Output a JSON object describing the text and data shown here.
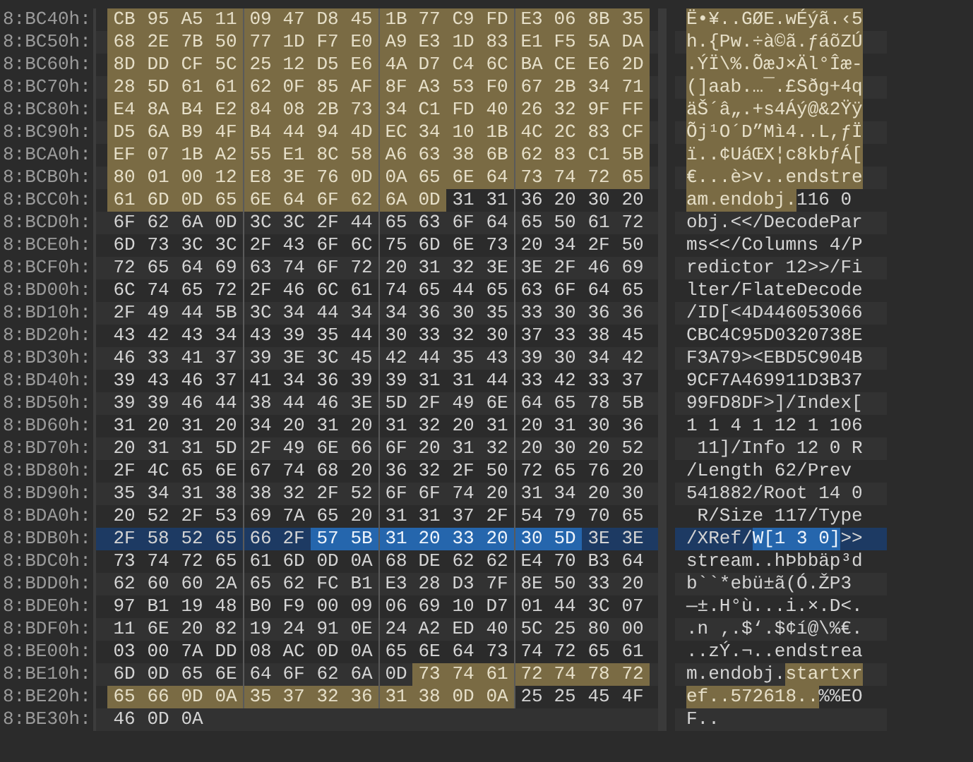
{
  "rows": [
    {
      "address": "8:BC40h:",
      "current": false,
      "segments": [
        {
          "kind": "marked",
          "bytes": "CB 95 A5 11 09 47 D8 45 1B 77 C9 FD E3 06 8B 35",
          "text": "Ë•¥..GØE.wÉýã.‹5"
        }
      ]
    },
    {
      "address": "8:BC50h:",
      "current": false,
      "segments": [
        {
          "kind": "marked",
          "bytes": "68 2E 7B 50 77 1D F7 E0 A9 E3 1D 83 E1 F5 5A DA",
          "text": "h.{Pw.÷à©ã.ƒáõZÚ"
        }
      ]
    },
    {
      "address": "8:BC60h:",
      "current": false,
      "segments": [
        {
          "kind": "marked",
          "bytes": "8D DD CF 5C 25 12 D5 E6 4A D7 C4 6C BA CE E6 2D",
          "text": ".ÝÏ\\%.ÕæJ×Äl°Îæ-"
        }
      ]
    },
    {
      "address": "8:BC70h:",
      "current": false,
      "segments": [
        {
          "kind": "marked",
          "bytes": "28 5D 61 61 62 0F 85 AF 8F A3 53 F0 67 2B 34 71",
          "text": "(]aab.…¯.£Sðg+4q"
        }
      ]
    },
    {
      "address": "8:BC80h:",
      "current": false,
      "segments": [
        {
          "kind": "marked",
          "bytes": "E4 8A B4 E2 84 08 2B 73 34 C1 FD 40 26 32 9F FF",
          "text": "äŠ´â„.+s4Áý@&2Ÿÿ"
        }
      ]
    },
    {
      "address": "8:BC90h:",
      "current": false,
      "segments": [
        {
          "kind": "marked",
          "bytes": "D5 6A B9 4F B4 44 94 4D EC 34 10 1B 4C 2C 83 CF",
          "text": "Õj¹O´D”Mì4..L,ƒÏ"
        }
      ]
    },
    {
      "address": "8:BCA0h:",
      "current": false,
      "segments": [
        {
          "kind": "marked",
          "bytes": "EF 07 1B A2 55 E1 8C 58 A6 63 38 6B 62 83 C1 5B",
          "text": "ï..¢UáŒX¦c8kbƒÁ["
        }
      ]
    },
    {
      "address": "8:BCB0h:",
      "current": false,
      "segments": [
        {
          "kind": "marked",
          "bytes": "80 01 00 12 E8 3E 76 0D 0A 65 6E 64 73 74 72 65",
          "text": "€...è>v..endstre"
        }
      ]
    },
    {
      "address": "8:BCC0h:",
      "current": false,
      "segments": [
        {
          "kind": "marked",
          "bytes": "61 6D 0D 65 6E 64 6F 62 6A 0D",
          "text": "am.endobj."
        },
        {
          "kind": "plain",
          "bytes": "31 31 36 20 30 20",
          "text": "116 0 "
        }
      ]
    },
    {
      "address": "8:BCD0h:",
      "current": false,
      "segments": [
        {
          "kind": "plain",
          "bytes": "6F 62 6A 0D 3C 3C 2F 44 65 63 6F 64 65 50 61 72",
          "text": "obj.<</DecodePar"
        }
      ]
    },
    {
      "address": "8:BCE0h:",
      "current": false,
      "segments": [
        {
          "kind": "plain",
          "bytes": "6D 73 3C 3C 2F 43 6F 6C 75 6D 6E 73 20 34 2F 50",
          "text": "ms<</Columns 4/P"
        }
      ]
    },
    {
      "address": "8:BCF0h:",
      "current": false,
      "segments": [
        {
          "kind": "plain",
          "bytes": "72 65 64 69 63 74 6F 72 20 31 32 3E 3E 2F 46 69",
          "text": "redictor 12>>/Fi"
        }
      ]
    },
    {
      "address": "8:BD00h:",
      "current": false,
      "segments": [
        {
          "kind": "plain",
          "bytes": "6C 74 65 72 2F 46 6C 61 74 65 44 65 63 6F 64 65",
          "text": "lter/FlateDecode"
        }
      ]
    },
    {
      "address": "8:BD10h:",
      "current": false,
      "segments": [
        {
          "kind": "plain",
          "bytes": "2F 49 44 5B 3C 34 44 34 34 36 30 35 33 30 36 36",
          "text": "/ID[<4D446053066"
        }
      ]
    },
    {
      "address": "8:BD20h:",
      "current": false,
      "segments": [
        {
          "kind": "plain",
          "bytes": "43 42 43 34 43 39 35 44 30 33 32 30 37 33 38 45",
          "text": "CBC4C95D0320738E"
        }
      ]
    },
    {
      "address": "8:BD30h:",
      "current": false,
      "segments": [
        {
          "kind": "plain",
          "bytes": "46 33 41 37 39 3E 3C 45 42 44 35 43 39 30 34 42",
          "text": "F3A79><EBD5C904B"
        }
      ]
    },
    {
      "address": "8:BD40h:",
      "current": false,
      "segments": [
        {
          "kind": "plain",
          "bytes": "39 43 46 37 41 34 36 39 39 31 31 44 33 42 33 37",
          "text": "9CF7A469911D3B37"
        }
      ]
    },
    {
      "address": "8:BD50h:",
      "current": false,
      "segments": [
        {
          "kind": "plain",
          "bytes": "39 39 46 44 38 44 46 3E 5D 2F 49 6E 64 65 78 5B",
          "text": "99FD8DF>]/Index["
        }
      ]
    },
    {
      "address": "8:BD60h:",
      "current": false,
      "segments": [
        {
          "kind": "plain",
          "bytes": "31 20 31 20 34 20 31 20 31 32 20 31 20 31 30 36",
          "text": "1 1 4 1 12 1 106"
        }
      ]
    },
    {
      "address": "8:BD70h:",
      "current": false,
      "segments": [
        {
          "kind": "plain",
          "bytes": "20 31 31 5D 2F 49 6E 66 6F 20 31 32 20 30 20 52",
          "text": " 11]/Info 12 0 R"
        }
      ]
    },
    {
      "address": "8:BD80h:",
      "current": false,
      "segments": [
        {
          "kind": "plain",
          "bytes": "2F 4C 65 6E 67 74 68 20 36 32 2F 50 72 65 76 20",
          "text": "/Length 62/Prev "
        }
      ]
    },
    {
      "address": "8:BD90h:",
      "current": false,
      "segments": [
        {
          "kind": "plain",
          "bytes": "35 34 31 38 38 32 2F 52 6F 6F 74 20 31 34 20 30",
          "text": "541882/Root 14 0"
        }
      ]
    },
    {
      "address": "8:BDA0h:",
      "current": false,
      "segments": [
        {
          "kind": "plain",
          "bytes": "20 52 2F 53 69 7A 65 20 31 31 37 2F 54 79 70 65",
          "text": " R/Size 117/Type"
        }
      ]
    },
    {
      "address": "8:BDB0h:",
      "current": true,
      "segments": [
        {
          "kind": "plain",
          "bytes": "2F 58 52 65 66 2F",
          "text": "/XRef/"
        },
        {
          "kind": "selected",
          "bytes": "57 5B 31 20 33 20 30 5D",
          "text": "W[1 3 0]"
        },
        {
          "kind": "plain",
          "bytes": "3E 3E",
          "text": ">>"
        }
      ]
    },
    {
      "address": "8:BDC0h:",
      "current": false,
      "segments": [
        {
          "kind": "plain",
          "bytes": "73 74 72 65 61 6D 0D 0A 68 DE 62 62 E4 70 B3 64",
          "text": "stream..hÞbbäp³d"
        }
      ]
    },
    {
      "address": "8:BDD0h:",
      "current": false,
      "segments": [
        {
          "kind": "plain",
          "bytes": "62 60 60 2A 65 62 FC B1 E3 28 D3 7F 8E 50 33 20",
          "text": "b``*ebü±ã(Ó.ŽP3 "
        }
      ]
    },
    {
      "address": "8:BDE0h:",
      "current": false,
      "segments": [
        {
          "kind": "plain",
          "bytes": "97 B1 19 48 B0 F9 00 09 06 69 10 D7 01 44 3C 07",
          "text": "—±.H°ù...i.×.D<."
        }
      ]
    },
    {
      "address": "8:BDF0h:",
      "current": false,
      "segments": [
        {
          "kind": "plain",
          "bytes": "11 6E 20 82 19 24 91 0E 24 A2 ED 40 5C 25 80 00",
          "text": ".n ‚.$‘.$¢í@\\%€."
        }
      ]
    },
    {
      "address": "8:BE00h:",
      "current": false,
      "segments": [
        {
          "kind": "plain",
          "bytes": "03 00 7A DD 08 AC 0D 0A 65 6E 64 73 74 72 65 61",
          "text": "..zÝ.¬..endstrea"
        }
      ]
    },
    {
      "address": "8:BE10h:",
      "current": false,
      "segments": [
        {
          "kind": "plain",
          "bytes": "6D 0D 65 6E 64 6F 62 6A 0D",
          "text": "m.endobj."
        },
        {
          "kind": "marked",
          "bytes": "73 74 61 72 74 78 72",
          "text": "startxr"
        }
      ]
    },
    {
      "address": "8:BE20h:",
      "current": false,
      "segments": [
        {
          "kind": "marked",
          "bytes": "65 66 0D 0A 35 37 32 36 31 38 0D 0A",
          "text": "ef..572618.."
        },
        {
          "kind": "plain",
          "bytes": "25 25 45 4F",
          "text": "%%EO"
        }
      ]
    },
    {
      "address": "8:BE30h:",
      "current": false,
      "segments": [
        {
          "kind": "plain",
          "bytes": "46 0D 0A",
          "text": "F.."
        }
      ]
    }
  ]
}
